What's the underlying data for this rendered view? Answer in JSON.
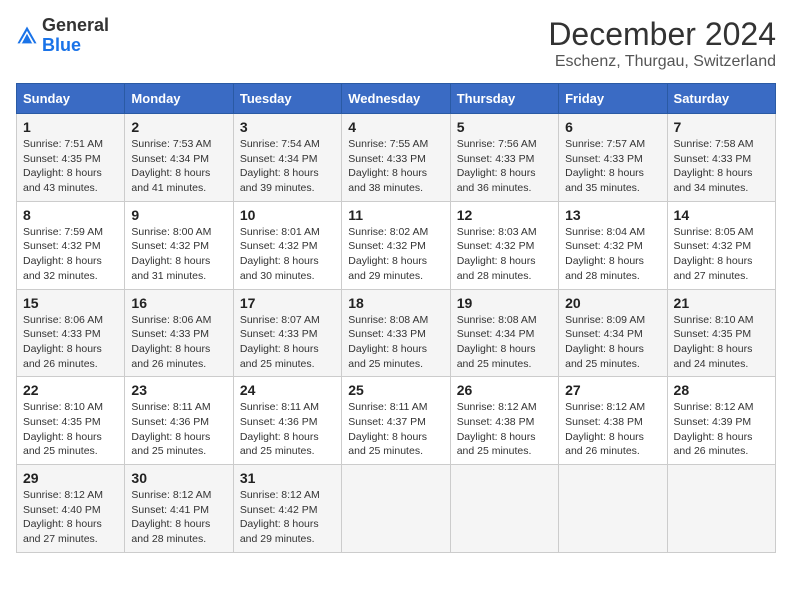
{
  "header": {
    "logo_general": "General",
    "logo_blue": "Blue",
    "month": "December 2024",
    "location": "Eschenz, Thurgau, Switzerland"
  },
  "days_of_week": [
    "Sunday",
    "Monday",
    "Tuesday",
    "Wednesday",
    "Thursday",
    "Friday",
    "Saturday"
  ],
  "weeks": [
    [
      {
        "day": "1",
        "sunrise": "Sunrise: 7:51 AM",
        "sunset": "Sunset: 4:35 PM",
        "daylight": "Daylight: 8 hours and 43 minutes."
      },
      {
        "day": "2",
        "sunrise": "Sunrise: 7:53 AM",
        "sunset": "Sunset: 4:34 PM",
        "daylight": "Daylight: 8 hours and 41 minutes."
      },
      {
        "day": "3",
        "sunrise": "Sunrise: 7:54 AM",
        "sunset": "Sunset: 4:34 PM",
        "daylight": "Daylight: 8 hours and 39 minutes."
      },
      {
        "day": "4",
        "sunrise": "Sunrise: 7:55 AM",
        "sunset": "Sunset: 4:33 PM",
        "daylight": "Daylight: 8 hours and 38 minutes."
      },
      {
        "day": "5",
        "sunrise": "Sunrise: 7:56 AM",
        "sunset": "Sunset: 4:33 PM",
        "daylight": "Daylight: 8 hours and 36 minutes."
      },
      {
        "day": "6",
        "sunrise": "Sunrise: 7:57 AM",
        "sunset": "Sunset: 4:33 PM",
        "daylight": "Daylight: 8 hours and 35 minutes."
      },
      {
        "day": "7",
        "sunrise": "Sunrise: 7:58 AM",
        "sunset": "Sunset: 4:33 PM",
        "daylight": "Daylight: 8 hours and 34 minutes."
      }
    ],
    [
      {
        "day": "8",
        "sunrise": "Sunrise: 7:59 AM",
        "sunset": "Sunset: 4:32 PM",
        "daylight": "Daylight: 8 hours and 32 minutes."
      },
      {
        "day": "9",
        "sunrise": "Sunrise: 8:00 AM",
        "sunset": "Sunset: 4:32 PM",
        "daylight": "Daylight: 8 hours and 31 minutes."
      },
      {
        "day": "10",
        "sunrise": "Sunrise: 8:01 AM",
        "sunset": "Sunset: 4:32 PM",
        "daylight": "Daylight: 8 hours and 30 minutes."
      },
      {
        "day": "11",
        "sunrise": "Sunrise: 8:02 AM",
        "sunset": "Sunset: 4:32 PM",
        "daylight": "Daylight: 8 hours and 29 minutes."
      },
      {
        "day": "12",
        "sunrise": "Sunrise: 8:03 AM",
        "sunset": "Sunset: 4:32 PM",
        "daylight": "Daylight: 8 hours and 28 minutes."
      },
      {
        "day": "13",
        "sunrise": "Sunrise: 8:04 AM",
        "sunset": "Sunset: 4:32 PM",
        "daylight": "Daylight: 8 hours and 28 minutes."
      },
      {
        "day": "14",
        "sunrise": "Sunrise: 8:05 AM",
        "sunset": "Sunset: 4:32 PM",
        "daylight": "Daylight: 8 hours and 27 minutes."
      }
    ],
    [
      {
        "day": "15",
        "sunrise": "Sunrise: 8:06 AM",
        "sunset": "Sunset: 4:33 PM",
        "daylight": "Daylight: 8 hours and 26 minutes."
      },
      {
        "day": "16",
        "sunrise": "Sunrise: 8:06 AM",
        "sunset": "Sunset: 4:33 PM",
        "daylight": "Daylight: 8 hours and 26 minutes."
      },
      {
        "day": "17",
        "sunrise": "Sunrise: 8:07 AM",
        "sunset": "Sunset: 4:33 PM",
        "daylight": "Daylight: 8 hours and 25 minutes."
      },
      {
        "day": "18",
        "sunrise": "Sunrise: 8:08 AM",
        "sunset": "Sunset: 4:33 PM",
        "daylight": "Daylight: 8 hours and 25 minutes."
      },
      {
        "day": "19",
        "sunrise": "Sunrise: 8:08 AM",
        "sunset": "Sunset: 4:34 PM",
        "daylight": "Daylight: 8 hours and 25 minutes."
      },
      {
        "day": "20",
        "sunrise": "Sunrise: 8:09 AM",
        "sunset": "Sunset: 4:34 PM",
        "daylight": "Daylight: 8 hours and 25 minutes."
      },
      {
        "day": "21",
        "sunrise": "Sunrise: 8:10 AM",
        "sunset": "Sunset: 4:35 PM",
        "daylight": "Daylight: 8 hours and 24 minutes."
      }
    ],
    [
      {
        "day": "22",
        "sunrise": "Sunrise: 8:10 AM",
        "sunset": "Sunset: 4:35 PM",
        "daylight": "Daylight: 8 hours and 25 minutes."
      },
      {
        "day": "23",
        "sunrise": "Sunrise: 8:11 AM",
        "sunset": "Sunset: 4:36 PM",
        "daylight": "Daylight: 8 hours and 25 minutes."
      },
      {
        "day": "24",
        "sunrise": "Sunrise: 8:11 AM",
        "sunset": "Sunset: 4:36 PM",
        "daylight": "Daylight: 8 hours and 25 minutes."
      },
      {
        "day": "25",
        "sunrise": "Sunrise: 8:11 AM",
        "sunset": "Sunset: 4:37 PM",
        "daylight": "Daylight: 8 hours and 25 minutes."
      },
      {
        "day": "26",
        "sunrise": "Sunrise: 8:12 AM",
        "sunset": "Sunset: 4:38 PM",
        "daylight": "Daylight: 8 hours and 25 minutes."
      },
      {
        "day": "27",
        "sunrise": "Sunrise: 8:12 AM",
        "sunset": "Sunset: 4:38 PM",
        "daylight": "Daylight: 8 hours and 26 minutes."
      },
      {
        "day": "28",
        "sunrise": "Sunrise: 8:12 AM",
        "sunset": "Sunset: 4:39 PM",
        "daylight": "Daylight: 8 hours and 26 minutes."
      }
    ],
    [
      {
        "day": "29",
        "sunrise": "Sunrise: 8:12 AM",
        "sunset": "Sunset: 4:40 PM",
        "daylight": "Daylight: 8 hours and 27 minutes."
      },
      {
        "day": "30",
        "sunrise": "Sunrise: 8:12 AM",
        "sunset": "Sunset: 4:41 PM",
        "daylight": "Daylight: 8 hours and 28 minutes."
      },
      {
        "day": "31",
        "sunrise": "Sunrise: 8:12 AM",
        "sunset": "Sunset: 4:42 PM",
        "daylight": "Daylight: 8 hours and 29 minutes."
      },
      null,
      null,
      null,
      null
    ]
  ]
}
